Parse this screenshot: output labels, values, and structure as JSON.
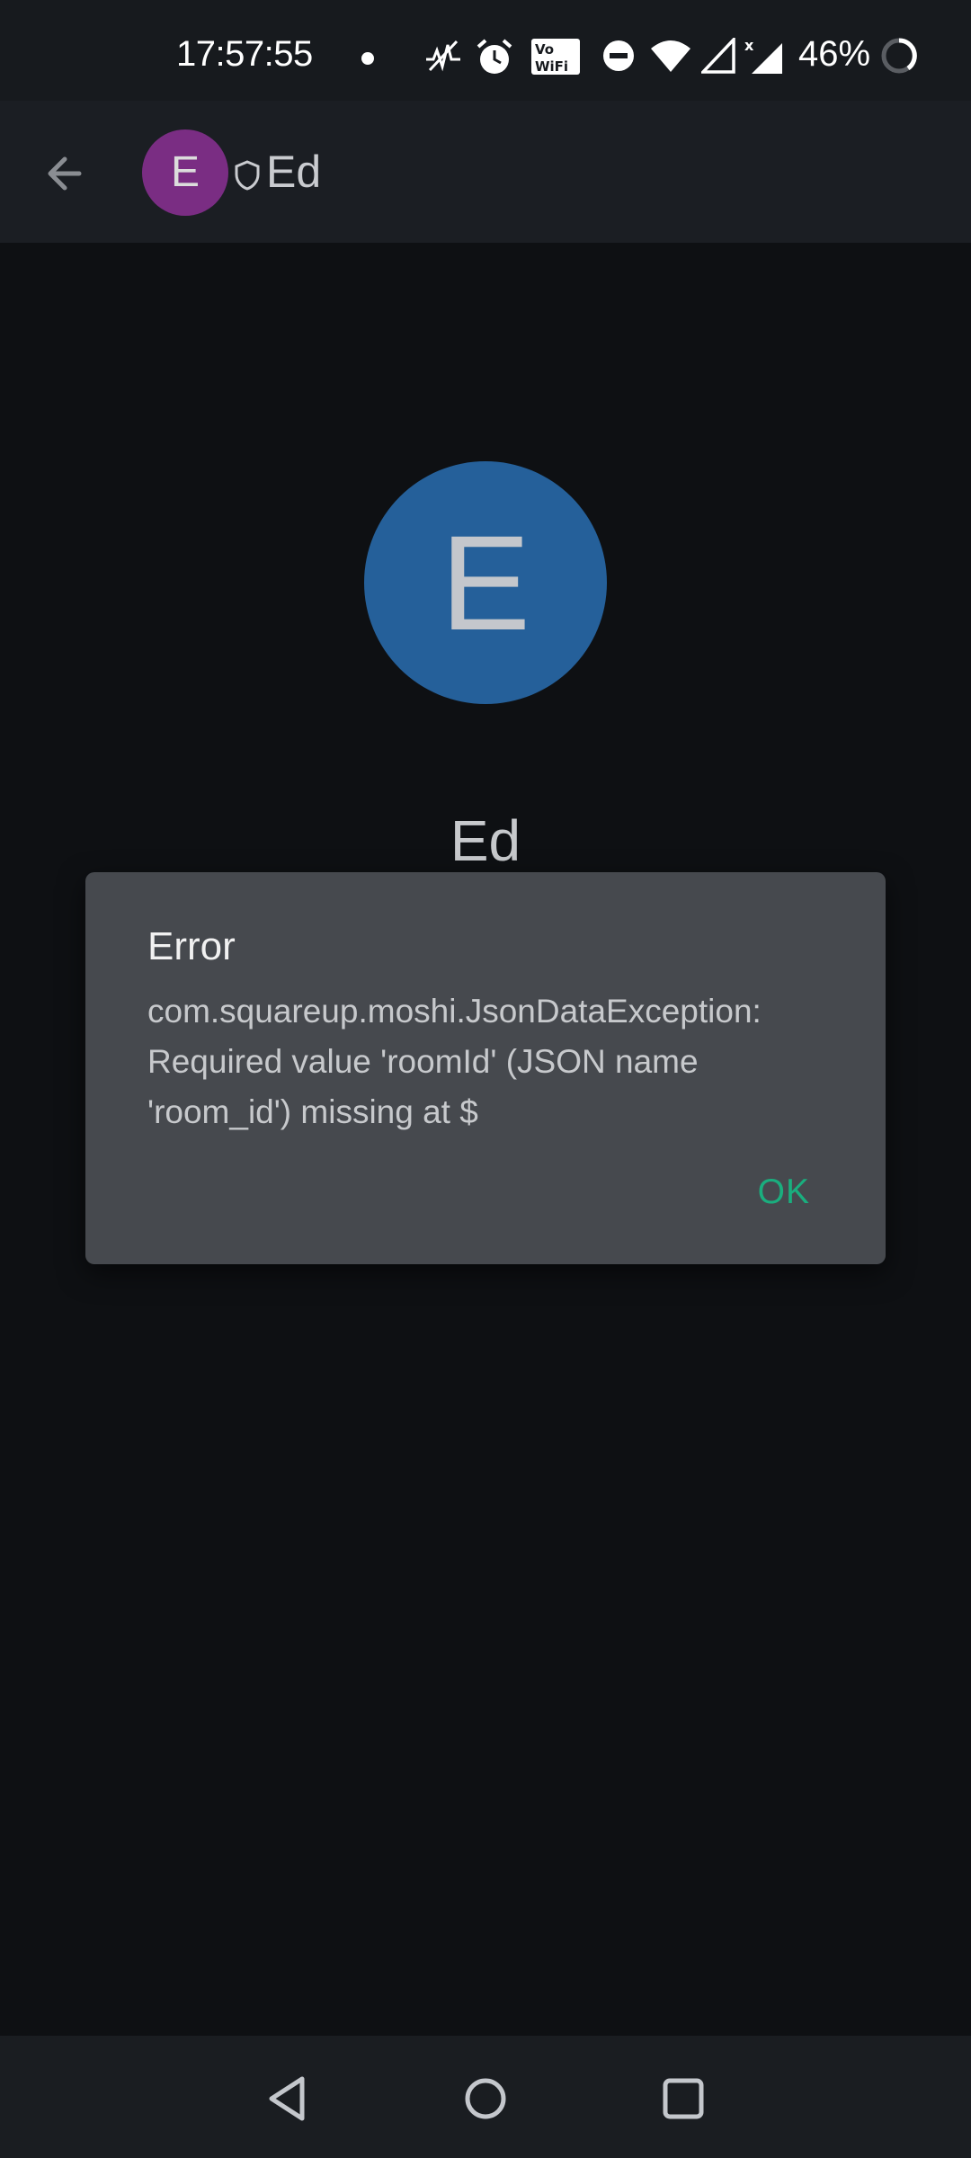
{
  "status_bar": {
    "time": "17:57:55",
    "battery": "46%",
    "icons": [
      "notification-dot-icon",
      "activity-icon",
      "alarm-icon",
      "vowifi-icon",
      "do-not-disturb-icon",
      "wifi-icon",
      "signal-icon",
      "signal-x-icon",
      "battery-icon"
    ]
  },
  "header": {
    "avatar_letter": "E",
    "title": "Ed",
    "avatar_color": "#7a2d83"
  },
  "profile": {
    "avatar_letter": "E",
    "name": "Ed",
    "avatar_color": "#25609a"
  },
  "dialog": {
    "title": "Error",
    "message": "com.squareup.moshi.JsonDataException: Required value 'roomId' (JSON name 'room_id') missing at $",
    "ok_label": "OK",
    "accent_color": "#1aae7e"
  },
  "nav_bar": {
    "icons": [
      "back-triangle-icon",
      "home-circle-icon",
      "recents-square-icon"
    ]
  }
}
